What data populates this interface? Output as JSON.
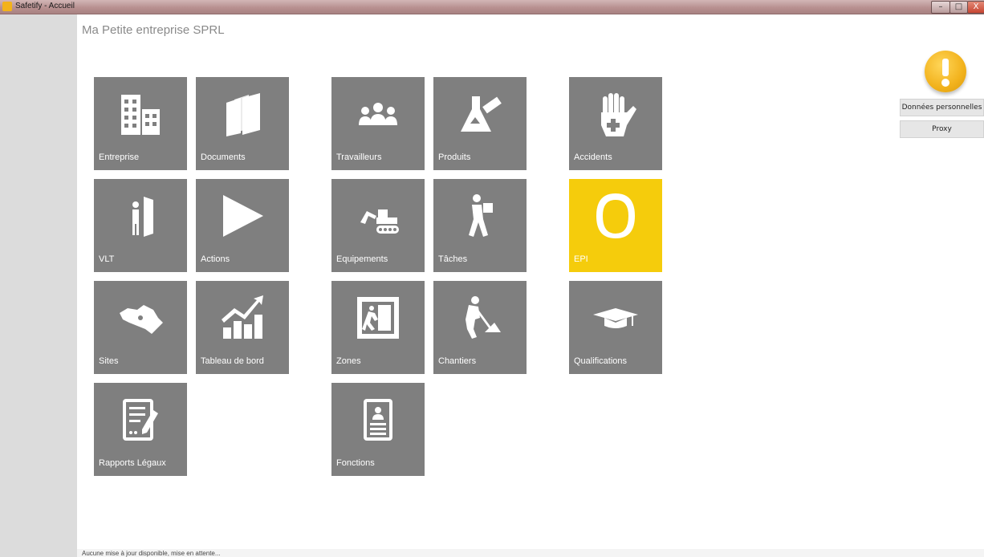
{
  "window": {
    "title": "Safetify - Accueil",
    "min": "–",
    "max": "□",
    "close": "X"
  },
  "company_name": "Ma Petite entreprise SPRL",
  "tiles": {
    "entreprise": "Entreprise",
    "documents": "Documents",
    "travailleurs": "Travailleurs",
    "produits": "Produits",
    "accidents": "Accidents",
    "vlt": "VLT",
    "actions": "Actions",
    "equipements": "Equipements",
    "taches": "Tâches",
    "epi": "EPI",
    "sites": "Sites",
    "tableau": "Tableau de bord",
    "zones": "Zones",
    "chantiers": "Chantiers",
    "qualifications": "Qualifications",
    "rapports": "Rapports Légaux",
    "fonctions": "Fonctions"
  },
  "colors": {
    "tile": "#7f7f7f",
    "active_tile": "#f5cc0c",
    "alert": "#f2b21c"
  },
  "side": {
    "personal_data": "Données personnelles",
    "proxy": "Proxy"
  },
  "status_text": "Aucune mise à jour disponible, mise en attente..."
}
